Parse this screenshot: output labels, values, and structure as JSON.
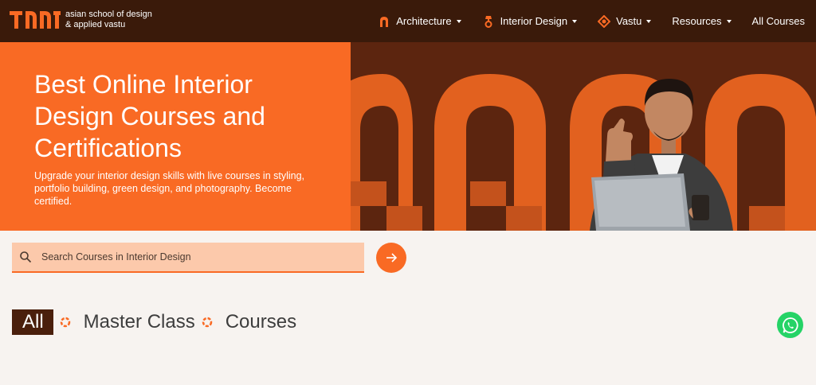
{
  "header": {
    "logo_line1": "asian school of design",
    "logo_line2": "& applied vastu",
    "nav": [
      {
        "label": "Architecture",
        "icon": "arch-icon",
        "dropdown": true
      },
      {
        "label": "Interior Design",
        "icon": "lamp-icon",
        "dropdown": true
      },
      {
        "label": "Vastu",
        "icon": "vastu-icon",
        "dropdown": true
      },
      {
        "label": "Resources",
        "dropdown": true
      },
      {
        "label": "All Courses",
        "dropdown": false
      }
    ]
  },
  "hero": {
    "title": "Best Online Interior Design Courses and Certifications",
    "subtitle": "Upgrade your interior design skills with live courses in styling, portfolio building, green design, and photography. Become certified."
  },
  "search": {
    "placeholder": "Search Courses in Interior Design"
  },
  "tabs": [
    {
      "label": "All",
      "active": true
    },
    {
      "label": "Master Class",
      "active": false
    },
    {
      "label": "Courses",
      "active": false
    }
  ],
  "colors": {
    "brand_orange": "#f96a24",
    "dark_brown": "#3a1a0a",
    "search_bg": "#fcc9ab",
    "whatsapp": "#25d366"
  }
}
